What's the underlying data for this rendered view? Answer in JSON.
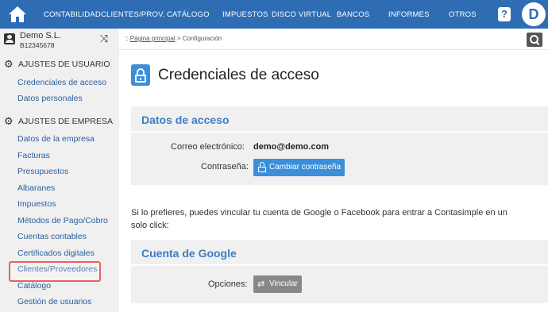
{
  "topnav": {
    "items": [
      "CONTABILIDAD",
      "CLIENTES/PROV.",
      "CATÁLOGO",
      "IMPUESTOS",
      "DISCO VIRTUAL",
      "BANCOS",
      "INFORMES",
      "OTROS"
    ],
    "help_label": "?",
    "avatar_initial": "D",
    "bar_color": "#2e6db4"
  },
  "sidebar": {
    "company_name": "Demo S.L.",
    "company_id": "B12345678",
    "user_section": {
      "title": "AJUSTES DE USUARIO",
      "items": [
        "Credenciales de acceso",
        "Datos personales"
      ]
    },
    "company_section": {
      "title": "AJUSTES DE EMPRESA",
      "items": [
        "Datos de la empresa",
        "Facturas",
        "Presupuestos",
        "Albaranes",
        "Impuestos",
        "Métodos de Pago/Cobro",
        "Cuentas contables",
        "Certificados digitales",
        "Clientes/Proveedores",
        "Catálogo",
        "Gestión de usuarios"
      ]
    }
  },
  "breadcrumb": {
    "prefix": "::",
    "home": "Página principal",
    "separator": ">",
    "current": "Configuración"
  },
  "main": {
    "title": "Credenciales de acceso",
    "access_card": {
      "title": "Datos de acceso",
      "email_label": "Correo electrónico:",
      "email_value": "demo@demo.com",
      "password_label": "Contraseña:",
      "change_password_button": "Cambiar contraseña"
    },
    "link_text": "Si lo prefieres, puedes vincular tu cuenta de Google o Facebook para entrar a Contasimple en un solo click:",
    "google_card": {
      "title": "Cuenta de Google",
      "options_label": "Opciones:",
      "link_button": "Vincular"
    }
  },
  "colors": {
    "accent": "#3a8fd8",
    "link": "#2a5f9e",
    "highlight": "#e86262"
  }
}
